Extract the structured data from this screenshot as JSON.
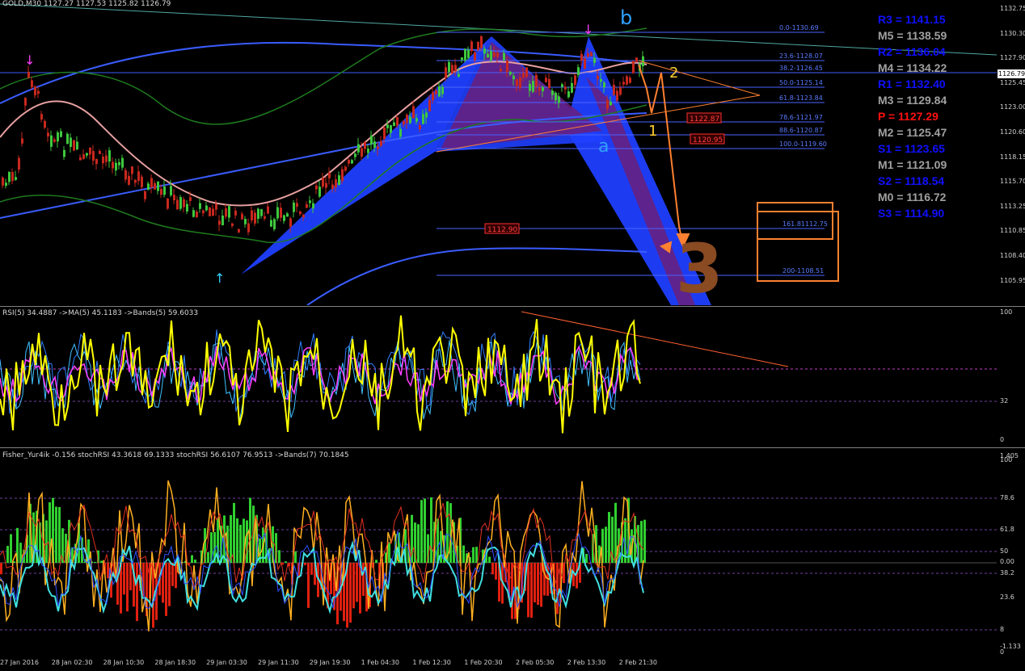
{
  "window": {
    "title": "GOLD,M30 1127.27 1127.53 1125.82 1126.79",
    "current_price": "1126.79"
  },
  "colors": {
    "background": "#000000",
    "grid": "#3a3a3a",
    "bullish_candle": "#3ec83e",
    "bearish_candle": "#c8281e",
    "pattern_fill": "#1f3fff",
    "pattern_inner": "#6a1f7a",
    "fib_line": "#4a63ff",
    "rsi_line": "#ffff00",
    "fisher_pos": "#30d030",
    "fisher_neg": "#e02010",
    "orange": "#ff8030"
  },
  "price_axis": {
    "ticks": [
      "1132.75",
      "1130.30",
      "1127.90",
      "1125.45",
      "1123.00",
      "1120.60",
      "1118.15",
      "1115.70",
      "1113.25",
      "1110.85",
      "1108.40",
      "1105.95"
    ]
  },
  "fib_levels": [
    {
      "label": "0.0-1130.69"
    },
    {
      "label": "23.6-1128.07"
    },
    {
      "label": "38.2-1126.45"
    },
    {
      "label": "50.0-1125.14"
    },
    {
      "label": "61.8-1123.84"
    },
    {
      "label": "78.6-1121.97"
    },
    {
      "label": "88.6-1120.87"
    },
    {
      "label": "100.0-1119.60"
    },
    {
      "label": "161.81112.75"
    },
    {
      "label": "200-1108.51"
    }
  ],
  "price_tags": [
    "1122.87",
    "1120.95",
    "1112.90"
  ],
  "pattern_labels": {
    "a": "a",
    "b": "b",
    "one": "1",
    "two": "2",
    "three": "3"
  },
  "pivots": [
    {
      "label": "R3 = 1141.15",
      "color": "#1010ff"
    },
    {
      "label": "M5 = 1138.59",
      "color": "#a0a0a0"
    },
    {
      "label": "R2 = 1136.04",
      "color": "#1010ff"
    },
    {
      "label": "M4 = 1134.22",
      "color": "#a0a0a0"
    },
    {
      "label": "R1 = 1132.40",
      "color": "#1010ff"
    },
    {
      "label": "M3 = 1129.84",
      "color": "#a0a0a0"
    },
    {
      "label": "P  = 1127.29",
      "color": "#ff1010"
    },
    {
      "label": "M2 = 1125.47",
      "color": "#a0a0a0"
    },
    {
      "label": "S1 = 1123.65",
      "color": "#1010ff"
    },
    {
      "label": "M1 = 1121.09",
      "color": "#a0a0a0"
    },
    {
      "label": "S2 = 1118.54",
      "color": "#1010ff"
    },
    {
      "label": "M0 = 1116.72",
      "color": "#a0a0a0"
    },
    {
      "label": "S3 = 1114.90",
      "color": "#1010ff"
    }
  ],
  "rsi_pane": {
    "label": "RSI(5) 34.4887  ->MA(5) 45.1183  ->Bands(5) 59.6033",
    "axis_ticks": [
      "100",
      "32",
      "0"
    ]
  },
  "fisher_pane": {
    "label": "Fisher_Yur4ik -0.156  stochRSI 43.3618 69.1333  stochRSI 56.6107 76.9513  ->Bands(7) 70.1845",
    "axis_ticks": [
      "1.405",
      "100",
      "78.6",
      "61.8",
      "50",
      "0.00",
      "38.2",
      "23.6",
      "8",
      "-1.133",
      "0"
    ]
  },
  "time_axis": [
    "27 Jan 2016",
    "28 Jan 02:30",
    "28 Jan 10:30",
    "28 Jan 18:30",
    "29 Jan 03:30",
    "29 Jan 11:30",
    "29 Jan 19:30",
    "1 Feb 04:30",
    "1 Feb 12:30",
    "1 Feb 20:30",
    "2 Feb 05:30",
    "2 Feb 13:30",
    "2 Feb 21:30"
  ]
}
